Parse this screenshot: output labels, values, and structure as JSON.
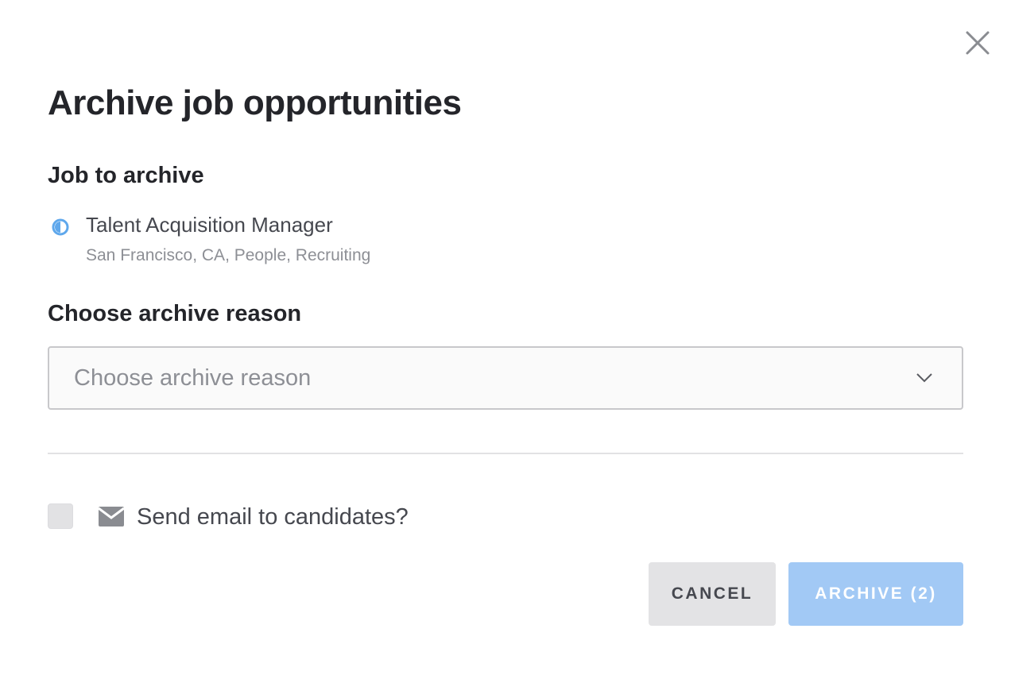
{
  "dialog": {
    "title": "Archive job opportunities",
    "close_icon": "close-icon"
  },
  "job_section": {
    "label": "Job to archive",
    "job": {
      "status_icon": "half-filled-circle-icon",
      "status_color": "#5fa8ec",
      "title": "Talent Acquisition Manager",
      "meta": "San Francisco, CA, People, Recruiting"
    }
  },
  "reason_section": {
    "label": "Choose archive reason",
    "select": {
      "placeholder": "Choose archive reason",
      "icon": "chevron-down-icon"
    }
  },
  "email_option": {
    "checked": false,
    "icon": "envelope-icon",
    "label": "Send email to candidates?"
  },
  "actions": {
    "cancel_label": "CANCEL",
    "archive_label": "ARCHIVE (2)",
    "archive_color": "#a2c9f5"
  }
}
